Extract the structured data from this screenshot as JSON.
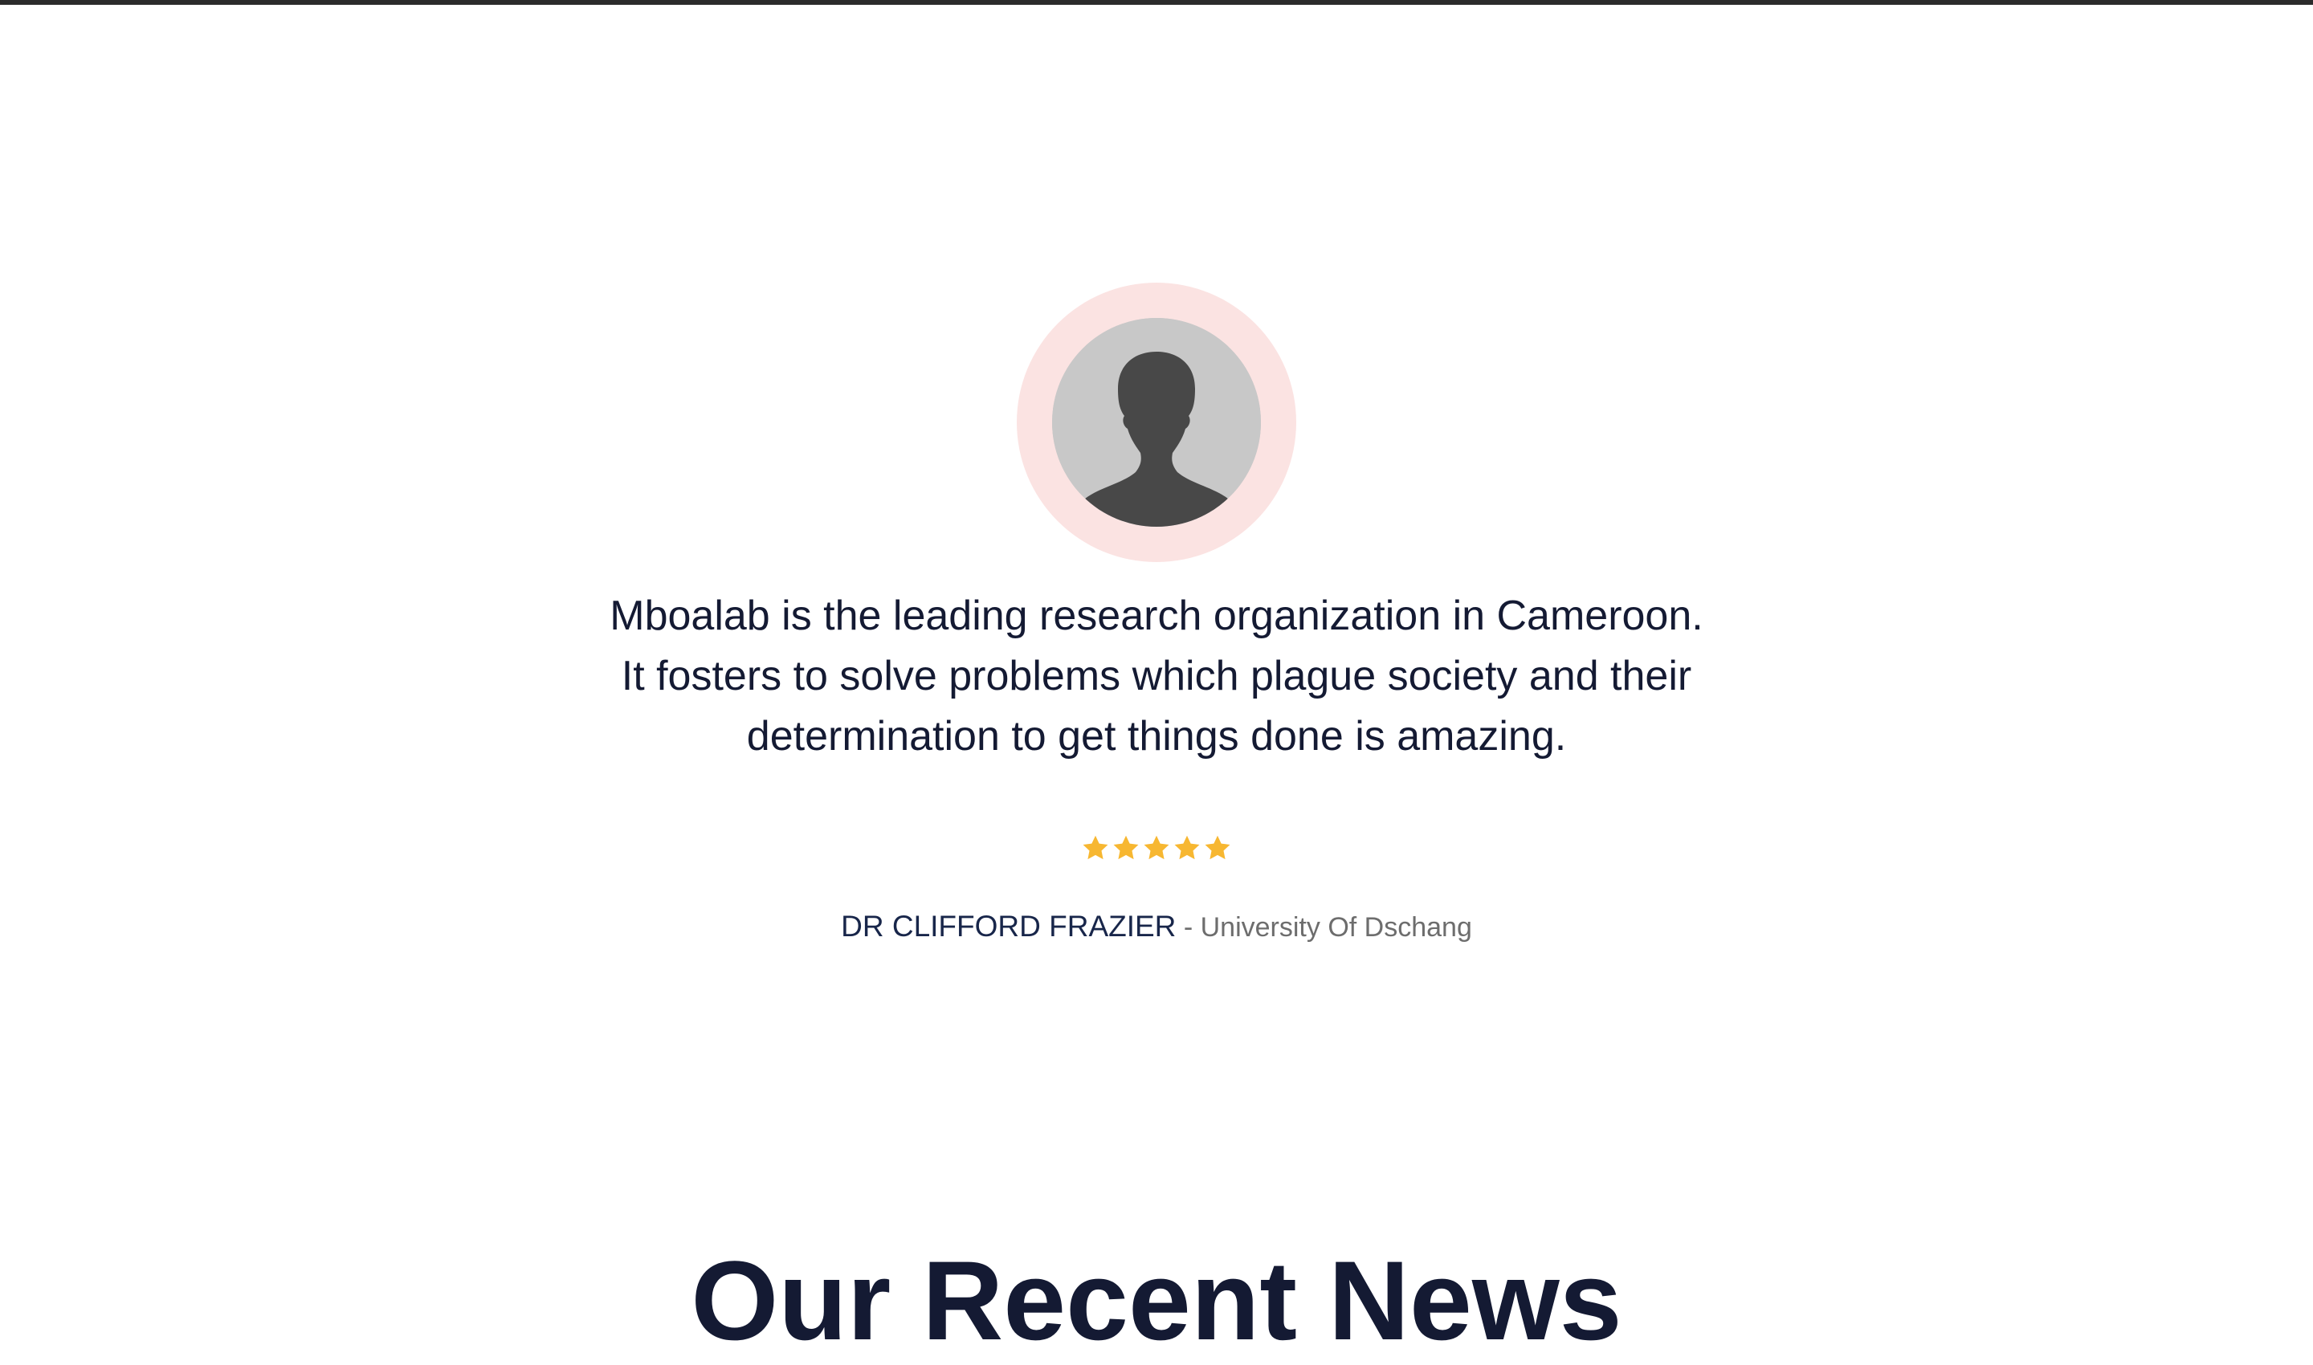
{
  "testimonial": {
    "avatar_icon": "user-silhouette-icon",
    "quote": "Mboalab is the leading research organization in Cameroon. It fosters to solve problems which plague society and their determination to get things done is amazing.",
    "rating": 5,
    "author_name": "DR CLIFFORD FRAZIER",
    "separator": " - ",
    "author_org": "University Of Dschang"
  },
  "next_section": {
    "heading": "Our Recent News"
  },
  "colors": {
    "avatar_ring": "#fbe3e2",
    "star": "#f7b731",
    "text_dark": "#141a33",
    "text_muted": "#6d6d6d"
  }
}
